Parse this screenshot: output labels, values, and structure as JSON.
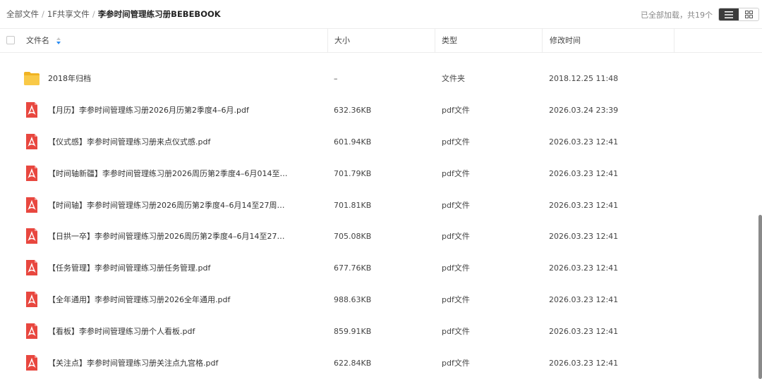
{
  "breadcrumb": {
    "items": [
      "全部文件",
      "1F共享文件"
    ],
    "current": "李参时间管理练习册BEBEBOOK",
    "separator": "/"
  },
  "status": {
    "loaded_text": "已全部加载，共19个"
  },
  "view_toggle": {
    "list_icon": "list-view-icon",
    "grid_icon": "grid-view-icon",
    "active": "list"
  },
  "columns": {
    "name": "文件名",
    "size": "大小",
    "type": "类型",
    "mtime": "修改时间"
  },
  "colors": {
    "folder": "#f7c23a",
    "pdf": "#e8473f",
    "active_toggle": "#3b3b3b"
  },
  "files": [
    {
      "name": "2018年归档",
      "size": "–",
      "type": "文件夹",
      "mtime": "2018.12.25 11:48",
      "icon": "folder-icon"
    },
    {
      "name": "【月历】李参时间管理练习册2026月历第2季度4–6月.pdf",
      "size": "632.36KB",
      "type": "pdf文件",
      "mtime": "2026.03.24 23:39",
      "icon": "pdf-icon"
    },
    {
      "name": "【仪式感】李参时间管理练习册来点仪式感.pdf",
      "size": "601.94KB",
      "type": "pdf文件",
      "mtime": "2026.03.23 12:41",
      "icon": "pdf-icon"
    },
    {
      "name": "【时间轴新疆】李参时间管理练习册2026周历第2季度4–6月014至…",
      "size": "701.79KB",
      "type": "pdf文件",
      "mtime": "2026.03.23 12:41",
      "icon": "pdf-icon"
    },
    {
      "name": "【时间轴】李参时间管理练习册2026周历第2季度4–6月14至27周…",
      "size": "701.81KB",
      "type": "pdf文件",
      "mtime": "2026.03.23 12:41",
      "icon": "pdf-icon"
    },
    {
      "name": "【日拱一卒】李参时间管理练习册2026周历第2季度4–6月14至27…",
      "size": "705.08KB",
      "type": "pdf文件",
      "mtime": "2026.03.23 12:41",
      "icon": "pdf-icon"
    },
    {
      "name": "【任务管理】李参时间管理练习册任务管理.pdf",
      "size": "677.76KB",
      "type": "pdf文件",
      "mtime": "2026.03.23 12:41",
      "icon": "pdf-icon"
    },
    {
      "name": "【全年通用】李参时间管理练习册2026全年通用.pdf",
      "size": "988.63KB",
      "type": "pdf文件",
      "mtime": "2026.03.23 12:41",
      "icon": "pdf-icon"
    },
    {
      "name": "【看板】李参时间管理练习册个人看板.pdf",
      "size": "859.91KB",
      "type": "pdf文件",
      "mtime": "2026.03.23 12:41",
      "icon": "pdf-icon"
    },
    {
      "name": "【关注点】李参时间管理练习册关注点九宫格.pdf",
      "size": "622.84KB",
      "type": "pdf文件",
      "mtime": "2026.03.23 12:41",
      "icon": "pdf-icon"
    }
  ]
}
